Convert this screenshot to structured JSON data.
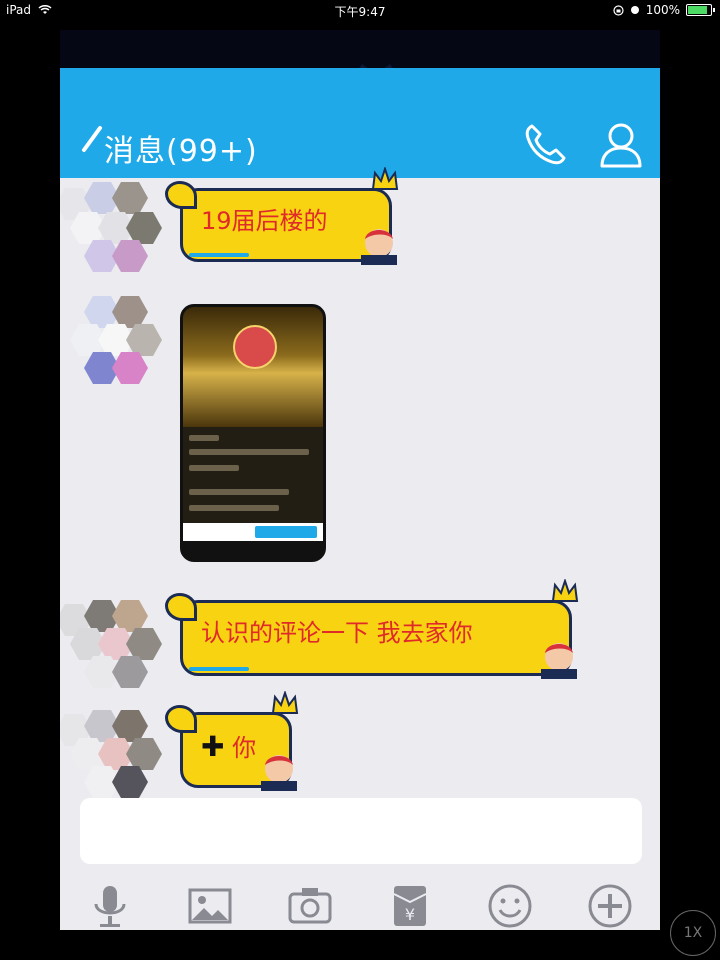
{
  "status_bar": {
    "device": "iPad",
    "time": "下午9:47",
    "battery": "100%"
  },
  "header": {
    "title": "消息(99+)"
  },
  "messages": [
    {
      "type": "text",
      "text": "19届后楼的"
    },
    {
      "type": "image"
    },
    {
      "type": "text",
      "text": "认识的评论一下 我去家你"
    },
    {
      "type": "text",
      "text": "你",
      "prefix_symbol": "✚"
    }
  ],
  "toolbar": {
    "icons": [
      "mic-icon",
      "image-icon",
      "camera-icon",
      "red-envelope-icon",
      "emoji-icon",
      "plus-icon"
    ]
  },
  "zoom_button": {
    "label": "1X"
  },
  "colors": {
    "header_blue": "#1fa9e8",
    "bubble_yellow": "#f7d312",
    "bubble_text_red": "#e02a2a",
    "bubble_border": "#1b2b54"
  }
}
